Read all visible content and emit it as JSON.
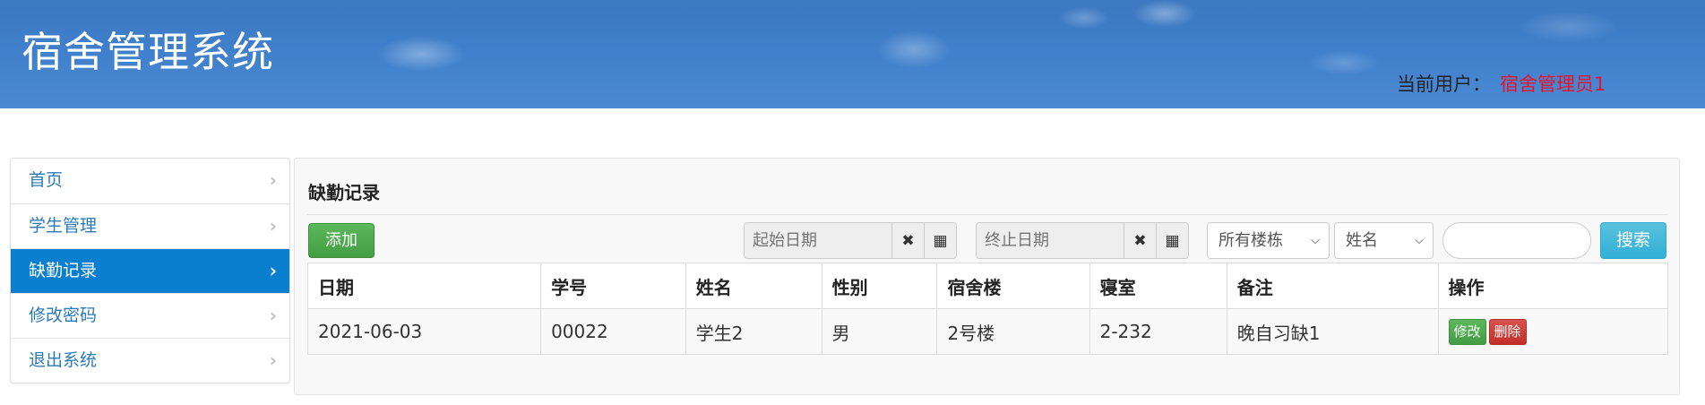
{
  "header": {
    "title": "宿舍管理系统",
    "user_label": "当前用户：",
    "user_name": "宿舍管理员1"
  },
  "sidebar": {
    "items": [
      {
        "label": "首页"
      },
      {
        "label": "学生管理"
      },
      {
        "label": "缺勤记录",
        "active": true
      },
      {
        "label": "修改密码"
      },
      {
        "label": "退出系统"
      }
    ],
    "chevron": "›"
  },
  "panel": {
    "title": "缺勤记录",
    "add_label": "添加",
    "start_date_placeholder": "起始日期",
    "end_date_placeholder": "终止日期",
    "clear_glyph": "✖",
    "calendar_glyph": "▦",
    "building_select": "所有楼栋",
    "field_select": "姓名",
    "search_value": "",
    "search_label": "搜索"
  },
  "table": {
    "headers": [
      "日期",
      "学号",
      "姓名",
      "性别",
      "宿舍楼",
      "寝室",
      "备注",
      "操作"
    ],
    "rows": [
      {
        "date": "2021-06-03",
        "student_no": "00022",
        "name": "学生2",
        "gender": "男",
        "building": "2号楼",
        "room": "2-232",
        "note": "晚自习缺1",
        "edit": "修改",
        "delete": "删除"
      }
    ]
  },
  "colors": {
    "header_bg": "#3f7fcb",
    "active_nav": "#0a7fd0",
    "user_name": "#e8142a",
    "add_button": "#5cb85c",
    "search_button": "#5bc0de",
    "delete_button": "#d9534f"
  }
}
